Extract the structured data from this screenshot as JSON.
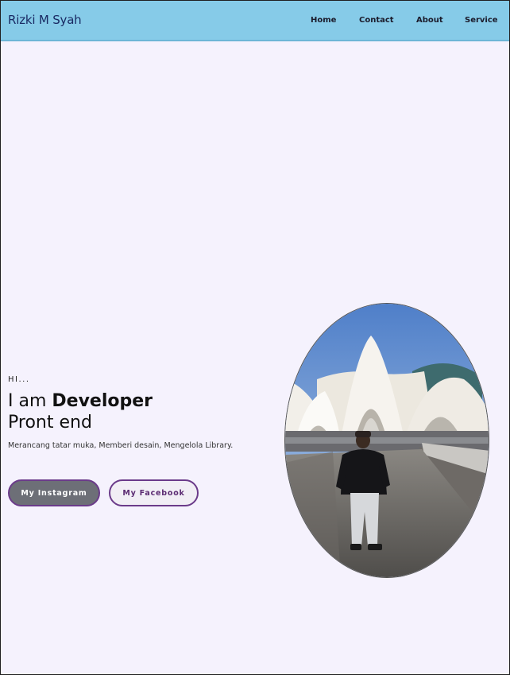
{
  "navbar": {
    "brand": "Rizki M Syah",
    "links": [
      {
        "label": "Home"
      },
      {
        "label": "Contact"
      },
      {
        "label": "About"
      },
      {
        "label": "Service"
      }
    ]
  },
  "hero": {
    "greeting": "HI...",
    "title_prefix": "I am ",
    "title_bold": "Developer",
    "title_line2": "Pront end",
    "subtitle": "Merancang tatar muka, Memberi desain, Mengelola Library.",
    "buttons": {
      "instagram": "My Instagram",
      "facebook": "My Facebook"
    }
  },
  "colors": {
    "navbar_bg": "#86cbe8",
    "page_bg": "#f5f2fd",
    "accent_border": "#6b3b8a"
  }
}
